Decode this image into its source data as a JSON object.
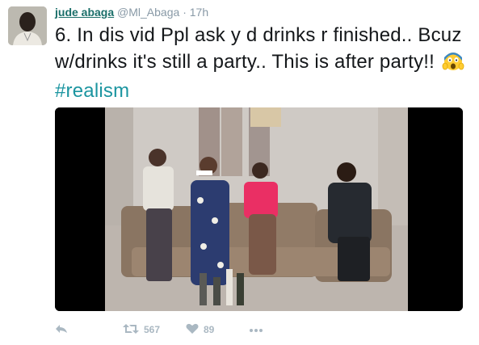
{
  "tweet": {
    "author_name": "jude abaga",
    "author_handle": "@Ml_Abaga",
    "separator": "·",
    "time": "17h",
    "text_main": "6. In dis vid Ppl ask y d drinks r finished.. Bcuz w/drinks it's still a party.. This is after party!!",
    "emoji_icon": "screaming-face-emoji",
    "hashtag": "#realism",
    "retweet_count": "567",
    "like_count": "89"
  },
  "colors": {
    "link": "#1b95a0",
    "author": "#1b6f6a",
    "muted": "#8899a6",
    "icon": "#aab8c2"
  }
}
